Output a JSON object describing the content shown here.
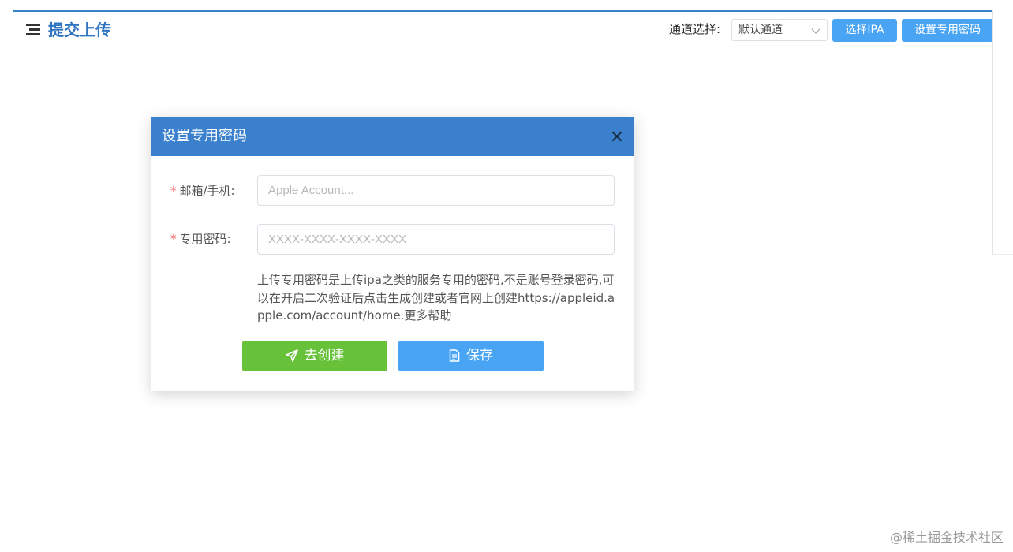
{
  "header": {
    "title": "提交上传",
    "channel_label": "通道选择:",
    "channel_selected": "默认通道",
    "select_ipa_label": "选择IPA",
    "set_password_label": "设置专用密码"
  },
  "dialog": {
    "title": "设置专用密码",
    "email_label": "邮箱/手机:",
    "email_placeholder": "Apple Account...",
    "email_value": "",
    "password_label": "专用密码:",
    "password_placeholder": "XXXX-XXXX-XXXX-XXXX",
    "password_value": "",
    "required_mark": "*",
    "help_text": "上传专用密码是上传ipa之类的服务专用的密码,不是账号登录密码,可以在开启二次验证后点击生成创建或者官网上创建https://appleid.apple.com/account/home.更多帮助",
    "create_button": "去创建",
    "save_button": "保存"
  },
  "icons": {
    "menu": "menu-icon",
    "close": "close-icon",
    "send": "send-icon",
    "document": "document-icon"
  },
  "colors": {
    "accent": "#3a80cc",
    "title_blue": "#2f74c1",
    "button_blue": "#4aa4f4",
    "button_green": "#67c23a",
    "required": "#f56c6c"
  },
  "watermark": "@稀土掘金技术社区"
}
